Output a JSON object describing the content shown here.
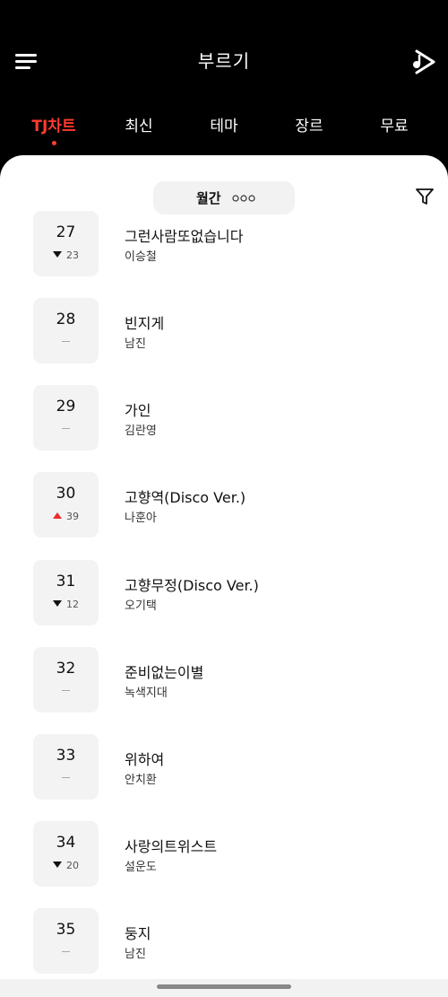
{
  "app": {
    "title": "부르기"
  },
  "tabs": [
    {
      "label": "TJ차트",
      "active": true
    },
    {
      "label": "최신",
      "active": false
    },
    {
      "label": "테마",
      "active": false
    },
    {
      "label": "장르",
      "active": false
    },
    {
      "label": "무료",
      "active": false
    }
  ],
  "filter": {
    "period_label": "월간"
  },
  "colors": {
    "accent": "#ff3b30",
    "rise": "#ee2b2b",
    "fall": "#111111"
  },
  "songs": [
    {
      "rank": "27",
      "change": "down",
      "change_value": "23",
      "title": "그런사람또없습니다",
      "artist": "이승철"
    },
    {
      "rank": "28",
      "change": "same",
      "change_value": "",
      "title": "빈지게",
      "artist": "남진"
    },
    {
      "rank": "29",
      "change": "same",
      "change_value": "",
      "title": "가인",
      "artist": "김란영"
    },
    {
      "rank": "30",
      "change": "up",
      "change_value": "39",
      "title": "고향역(Disco Ver.)",
      "artist": "나훈아"
    },
    {
      "rank": "31",
      "change": "down",
      "change_value": "12",
      "title": "고향무정(Disco Ver.)",
      "artist": "오기택"
    },
    {
      "rank": "32",
      "change": "same",
      "change_value": "",
      "title": "준비없는이별",
      "artist": "녹색지대"
    },
    {
      "rank": "33",
      "change": "same",
      "change_value": "",
      "title": "위하여",
      "artist": "안치환"
    },
    {
      "rank": "34",
      "change": "down",
      "change_value": "20",
      "title": "사랑의트위스트",
      "artist": "설운도"
    },
    {
      "rank": "35",
      "change": "same",
      "change_value": "",
      "title": "둥지",
      "artist": "남진"
    }
  ]
}
